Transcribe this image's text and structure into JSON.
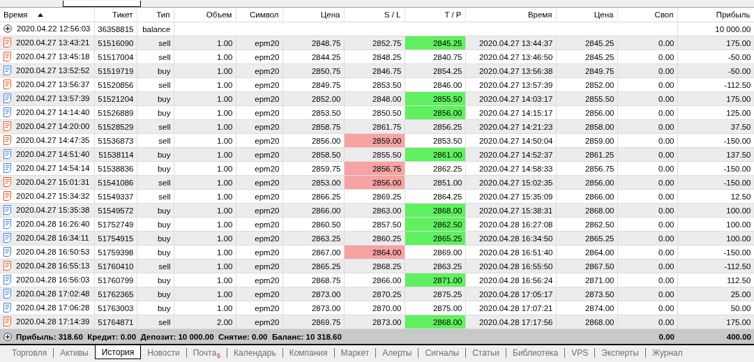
{
  "table": {
    "columns": [
      {
        "label": "Время",
        "sorted": true
      },
      {
        "label": "Тикет",
        "sorted": false
      },
      {
        "label": "Тип",
        "sorted": false
      },
      {
        "label": "Объем",
        "sorted": false
      },
      {
        "label": "Символ",
        "sorted": false
      },
      {
        "label": "Цена",
        "sorted": false
      },
      {
        "label": "S / L",
        "sorted": false
      },
      {
        "label": "T / P",
        "sorted": false
      },
      {
        "label": "Время",
        "sorted": false
      },
      {
        "label": "Цена",
        "sorted": false
      },
      {
        "label": "Своп",
        "sorted": false
      },
      {
        "label": "Прибыль",
        "sorted": false
      }
    ],
    "balance_row": {
      "time": "2020.04.22 12:56:03",
      "ticket": "36358815",
      "type": "balance",
      "profit": "10 000.00"
    },
    "rows": [
      {
        "kind": "sell",
        "time": "2020.04.27 13:43:21",
        "ticket": "51516090",
        "type": "sell",
        "volume": "1.00",
        "symbol": "epm20",
        "price": "2848.75",
        "sl": "2852.75",
        "tp": "2845.25",
        "tp_hit": true,
        "sl_hit": false,
        "close_time": "2020.04.27 13:44:37",
        "close_price": "2845.25",
        "swap": "0.00",
        "profit": "175.00"
      },
      {
        "kind": "sell",
        "time": "2020.04.27 13:45:18",
        "ticket": "51517004",
        "type": "sell",
        "volume": "1.00",
        "symbol": "epm20",
        "price": "2844.25",
        "sl": "2848.25",
        "tp": "2840.75",
        "tp_hit": false,
        "sl_hit": false,
        "close_time": "2020.04.27 13:46:50",
        "close_price": "2845.25",
        "swap": "0.00",
        "profit": "-50.00"
      },
      {
        "kind": "buy",
        "time": "2020.04.27 13:52:52",
        "ticket": "51519719",
        "type": "buy",
        "volume": "1.00",
        "symbol": "epm20",
        "price": "2850.75",
        "sl": "2846.75",
        "tp": "2854.25",
        "tp_hit": false,
        "sl_hit": false,
        "close_time": "2020.04.27 13:56:38",
        "close_price": "2849.75",
        "swap": "0.00",
        "profit": "-50.00"
      },
      {
        "kind": "sell",
        "time": "2020.04.27 13:56:37",
        "ticket": "51520856",
        "type": "sell",
        "volume": "1.00",
        "symbol": "epm20",
        "price": "2849.75",
        "sl": "2853.50",
        "tp": "2846.00",
        "tp_hit": false,
        "sl_hit": false,
        "close_time": "2020.04.27 13:57:39",
        "close_price": "2852.00",
        "swap": "0.00",
        "profit": "-112.50"
      },
      {
        "kind": "buy",
        "time": "2020.04.27 13:57:39",
        "ticket": "51521204",
        "type": "buy",
        "volume": "1.00",
        "symbol": "epm20",
        "price": "2852.00",
        "sl": "2848.00",
        "tp": "2855.50",
        "tp_hit": true,
        "sl_hit": false,
        "close_time": "2020.04.27 14:03:17",
        "close_price": "2855.50",
        "swap": "0.00",
        "profit": "175.00"
      },
      {
        "kind": "buy",
        "time": "2020.04.27 14:14:40",
        "ticket": "51526889",
        "type": "buy",
        "volume": "1.00",
        "symbol": "epm20",
        "price": "2853.50",
        "sl": "2850.50",
        "tp": "2856.00",
        "tp_hit": true,
        "sl_hit": false,
        "close_time": "2020.04.27 14:15:17",
        "close_price": "2856.00",
        "swap": "0.00",
        "profit": "125.00"
      },
      {
        "kind": "sell",
        "time": "2020.04.27 14:20:00",
        "ticket": "51528529",
        "type": "sell",
        "volume": "1.00",
        "symbol": "epm20",
        "price": "2858.75",
        "sl": "2861.75",
        "tp": "2856.25",
        "tp_hit": false,
        "sl_hit": false,
        "close_time": "2020.04.27 14:21:23",
        "close_price": "2858.00",
        "swap": "0.00",
        "profit": "37.50"
      },
      {
        "kind": "sell",
        "time": "2020.04.27 14:47:35",
        "ticket": "51536873",
        "type": "sell",
        "volume": "1.00",
        "symbol": "epm20",
        "price": "2856.00",
        "sl": "2859.00",
        "tp": "2853.50",
        "tp_hit": false,
        "sl_hit": true,
        "close_time": "2020.04.27 14:50:04",
        "close_price": "2859.00",
        "swap": "0.00",
        "profit": "-150.00"
      },
      {
        "kind": "buy",
        "time": "2020.04.27 14:51:40",
        "ticket": "51538114",
        "type": "buy",
        "volume": "1.00",
        "symbol": "epm20",
        "price": "2858.50",
        "sl": "2855.50",
        "tp": "2861.00",
        "tp_hit": true,
        "sl_hit": false,
        "close_time": "2020.04.27 14:52:37",
        "close_price": "2861.25",
        "swap": "0.00",
        "profit": "137.50"
      },
      {
        "kind": "buy",
        "time": "2020.04.27 14:54:14",
        "ticket": "51538836",
        "type": "buy",
        "volume": "1.00",
        "symbol": "epm20",
        "price": "2859.75",
        "sl": "2856.75",
        "tp": "2862.25",
        "tp_hit": false,
        "sl_hit": true,
        "close_time": "2020.04.27 14:58:33",
        "close_price": "2856.75",
        "swap": "0.00",
        "profit": "-150.00"
      },
      {
        "kind": "sell",
        "time": "2020.04.27 15:01:31",
        "ticket": "51541086",
        "type": "sell",
        "volume": "1.00",
        "symbol": "epm20",
        "price": "2853.00",
        "sl": "2856.00",
        "tp": "2851.00",
        "tp_hit": false,
        "sl_hit": true,
        "close_time": "2020.04.27 15:02:35",
        "close_price": "2856.00",
        "swap": "0.00",
        "profit": "-150.00"
      },
      {
        "kind": "sell",
        "time": "2020.04.27 15:34:32",
        "ticket": "51549337",
        "type": "sell",
        "volume": "1.00",
        "symbol": "epm20",
        "price": "2866.25",
        "sl": "2869.25",
        "tp": "2864.25",
        "tp_hit": false,
        "sl_hit": false,
        "close_time": "2020.04.27 15:35:09",
        "close_price": "2866.00",
        "swap": "0.00",
        "profit": "12.50"
      },
      {
        "kind": "buy",
        "time": "2020.04.27 15:35:38",
        "ticket": "51549572",
        "type": "buy",
        "volume": "1.00",
        "symbol": "epm20",
        "price": "2866.00",
        "sl": "2863.00",
        "tp": "2868.00",
        "tp_hit": true,
        "sl_hit": false,
        "close_time": "2020.04.27 15:38:31",
        "close_price": "2868.00",
        "swap": "0.00",
        "profit": "100.00"
      },
      {
        "kind": "buy",
        "time": "2020.04.28 16:26:40",
        "ticket": "51752749",
        "type": "buy",
        "volume": "1.00",
        "symbol": "epm20",
        "price": "2860.50",
        "sl": "2857.50",
        "tp": "2862.50",
        "tp_hit": true,
        "sl_hit": false,
        "close_time": "2020.04.28 16:27:08",
        "close_price": "2862.50",
        "swap": "0.00",
        "profit": "100.00"
      },
      {
        "kind": "buy",
        "time": "2020.04.28 16:34:11",
        "ticket": "51754915",
        "type": "buy",
        "volume": "1.00",
        "symbol": "epm20",
        "price": "2863.25",
        "sl": "2860.25",
        "tp": "2865.25",
        "tp_hit": true,
        "sl_hit": false,
        "close_time": "2020.04.28 16:34:50",
        "close_price": "2865.25",
        "swap": "0.00",
        "profit": "100.00"
      },
      {
        "kind": "buy",
        "time": "2020.04.28 16:50:53",
        "ticket": "51759398",
        "type": "buy",
        "volume": "1.00",
        "symbol": "epm20",
        "price": "2867.00",
        "sl": "2864.00",
        "tp": "2869.00",
        "tp_hit": false,
        "sl_hit": true,
        "close_time": "2020.04.28 16:51:40",
        "close_price": "2864.00",
        "swap": "0.00",
        "profit": "-150.00"
      },
      {
        "kind": "sell",
        "time": "2020.04.28 16:55:13",
        "ticket": "51760410",
        "type": "sell",
        "volume": "1.00",
        "symbol": "epm20",
        "price": "2865.25",
        "sl": "2868.25",
        "tp": "2863.25",
        "tp_hit": false,
        "sl_hit": false,
        "close_time": "2020.04.28 16:55:50",
        "close_price": "2867.50",
        "swap": "0.00",
        "profit": "-112.50"
      },
      {
        "kind": "buy",
        "time": "2020.04.28 16:56:03",
        "ticket": "51760799",
        "type": "buy",
        "volume": "1.00",
        "symbol": "epm20",
        "price": "2868.75",
        "sl": "2866.00",
        "tp": "2871.00",
        "tp_hit": true,
        "sl_hit": false,
        "close_time": "2020.04.28 16:56:24",
        "close_price": "2871.00",
        "swap": "0.00",
        "profit": "112.50"
      },
      {
        "kind": "buy",
        "time": "2020.04.28 17:02:48",
        "ticket": "51762365",
        "type": "buy",
        "volume": "1.00",
        "symbol": "epm20",
        "price": "2873.00",
        "sl": "2870.25",
        "tp": "2875.25",
        "tp_hit": false,
        "sl_hit": false,
        "close_time": "2020.04.28 17:05:17",
        "close_price": "2873.50",
        "swap": "0.00",
        "profit": "25.00"
      },
      {
        "kind": "buy",
        "time": "2020.04.28 17:06:28",
        "ticket": "51763003",
        "type": "buy",
        "volume": "1.00",
        "symbol": "epm20",
        "price": "2873.00",
        "sl": "2870.00",
        "tp": "2875.00",
        "tp_hit": false,
        "sl_hit": false,
        "close_time": "2020.04.28 17:07:21",
        "close_price": "2874.00",
        "swap": "0.00",
        "profit": "50.00"
      },
      {
        "kind": "sell",
        "time": "2020.04.28 17:14:39",
        "ticket": "51764871",
        "type": "sell",
        "volume": "2.00",
        "symbol": "epm20",
        "price": "2869.75",
        "sl": "2873.00",
        "tp": "2868.00",
        "tp_hit": true,
        "sl_hit": false,
        "close_time": "2020.04.28 17:17:56",
        "close_price": "2868.00",
        "swap": "0.00",
        "profit": "175.00"
      }
    ],
    "summary": {
      "text": "Прибыль: 318.60  Кредит: 0.00  Депозит: 10 000.00  Снятие: 0.00  Баланс: 10 318.60",
      "swap": "0.00",
      "profit": "400.00"
    }
  },
  "tabs": [
    {
      "label": "Торговля",
      "selected": false
    },
    {
      "label": "Активы",
      "selected": false
    },
    {
      "label": "История",
      "selected": true
    },
    {
      "label": "Новости",
      "selected": false
    },
    {
      "label": "Почта",
      "selected": false,
      "badge": "5"
    },
    {
      "label": "Календарь",
      "selected": false
    },
    {
      "label": "Компания",
      "selected": false
    },
    {
      "label": "Маркет",
      "selected": false
    },
    {
      "label": "Алерты",
      "selected": false
    },
    {
      "label": "Сигналы",
      "selected": false
    },
    {
      "label": "Статьи",
      "selected": false
    },
    {
      "label": "Библиотека",
      "selected": false
    },
    {
      "label": "VPS",
      "selected": false
    },
    {
      "label": "Эксперты",
      "selected": false
    },
    {
      "label": "Журнал",
      "selected": false
    }
  ]
}
